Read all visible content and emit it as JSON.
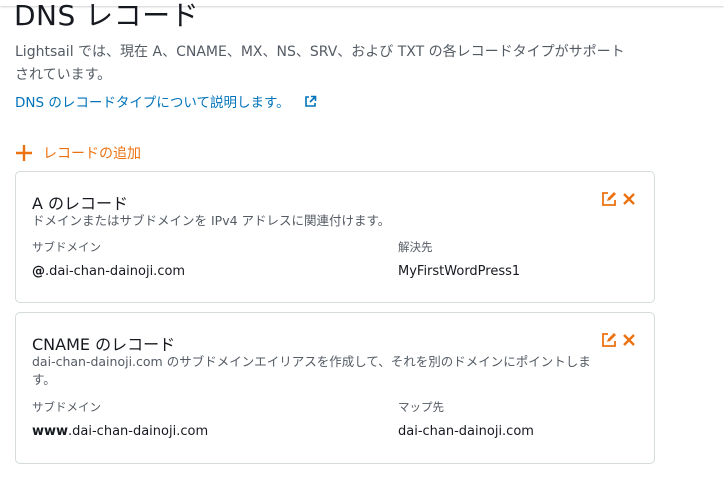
{
  "page": {
    "title": "DNS レコード",
    "description": "Lightsail では、現在 A、CNAME、MX、NS、SRV、および TXT の各レコードタイプがサポートされています。",
    "learn_link": "DNS のレコードタイプについて説明します。",
    "add_record": "レコードの追加"
  },
  "colors": {
    "accent": "#ec7211",
    "link": "#0073bb"
  },
  "icons": {
    "learn": "external-link-icon",
    "add": "plus-icon",
    "edit": "edit-icon",
    "delete": "close-icon"
  },
  "records": [
    {
      "title": "A のレコード",
      "description": "ドメインまたはサブドメインを IPv4 アドレスに関連付けます。",
      "left_label": "サブドメイン",
      "left_prefix": "@",
      "left_value": ".dai-chan-dainoji.com",
      "right_label": "解決先",
      "right_value": "MyFirstWordPress1"
    },
    {
      "title": "CNAME のレコード",
      "description": "dai-chan-dainoji.com のサブドメインエイリアスを作成して、それを別のドメインにポイントします。",
      "left_label": "サブドメイン",
      "left_prefix": "www",
      "left_value": ".dai-chan-dainoji.com",
      "right_label": "マップ先",
      "right_value": "dai-chan-dainoji.com"
    }
  ]
}
